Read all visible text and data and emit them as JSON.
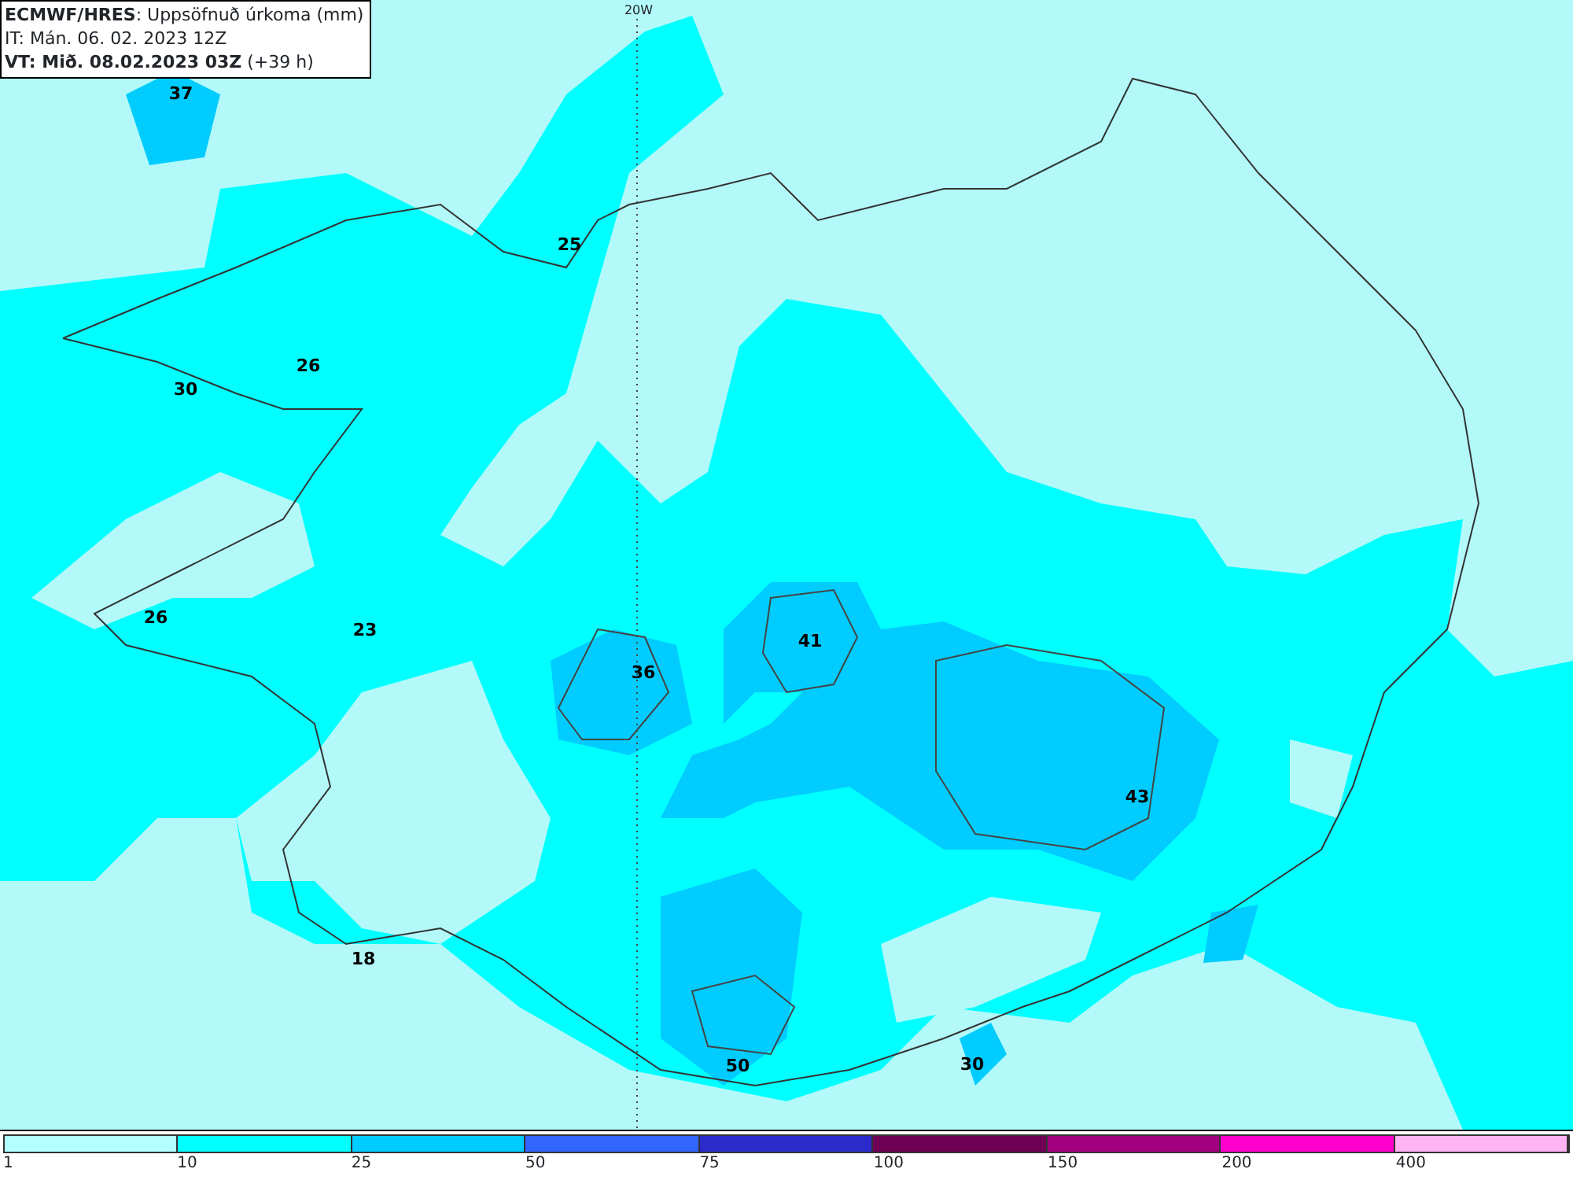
{
  "header": {
    "lines": [
      "**ECMWF/HRES**: Uppsöfnuð úrkoma (mm)",
      "IT: Mán. 06. 02. 2023 12Z",
      "**VT: Mið. 08.02.2023 03Z** (+39 h)"
    ]
  },
  "map": {
    "meridian_label": "20W",
    "values": [
      "37",
      "25",
      "26",
      "30",
      "26",
      "23",
      "36",
      "41",
      "43",
      "18",
      "50",
      "30"
    ]
  },
  "legend": [
    {
      "label": "1",
      "color": "#b3ffff"
    },
    {
      "label": "10",
      "color": "#00ffff"
    },
    {
      "label": "25",
      "color": "#00ccff"
    },
    {
      "label": "50",
      "color": "#3366ff"
    },
    {
      "label": "75",
      "color": "#2b2bcc"
    },
    {
      "label": "100",
      "color": "#6e0055"
    },
    {
      "label": "150",
      "color": "#a3007f"
    },
    {
      "label": "200",
      "color": "#ff00cc"
    },
    {
      "label": "400",
      "color": "#ffb3f2"
    }
  ]
}
